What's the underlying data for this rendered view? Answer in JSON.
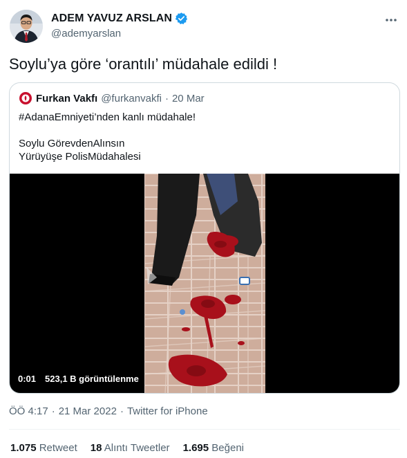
{
  "author": {
    "display_name": "ADEM YAVUZ ARSLAN",
    "handle": "@ademyarslan",
    "verified": true
  },
  "tweet": {
    "text": "Soylu’ya göre ‘orantılı’ müdahale edildi !"
  },
  "quoted": {
    "display_name": "Furkan Vakfı",
    "handle": "@furkanvakfi",
    "separator": "·",
    "date": "20 Mar",
    "line1": "#AdanaEmniyeti’nden kanlı müdahale!",
    "line2": "Soylu GörevdenAlınsın",
    "line3": "Yürüyüşe PolisMüdahalesi",
    "video": {
      "time": "0:01",
      "views": "523,1 B görüntülenme"
    }
  },
  "meta": {
    "time": "ÖÖ 4:17",
    "sep1": "·",
    "date": "21 Mar 2022",
    "sep2": "·",
    "source": "Twitter for iPhone"
  },
  "stats": {
    "retweets": {
      "count": "1.075",
      "label": "Retweet"
    },
    "quotes": {
      "count": "18",
      "label": "Alıntı Tweetler"
    },
    "likes": {
      "count": "1.695",
      "label": "Beğeni"
    }
  },
  "colors": {
    "verified": "#1d9bf0",
    "secondary_text": "#536471",
    "border": "#cfd9de",
    "blood": "#b3121c"
  }
}
